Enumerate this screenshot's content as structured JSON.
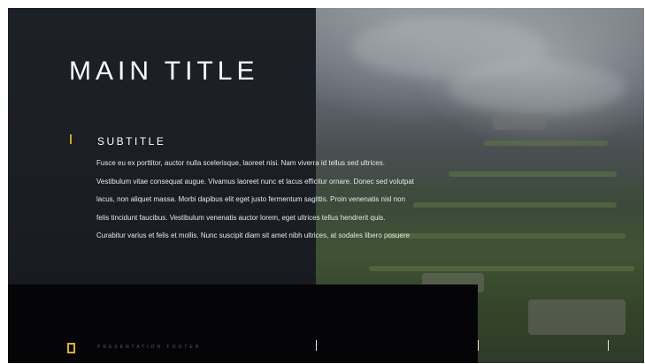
{
  "slide": {
    "title": "MAIN TITLE",
    "subtitle": "SUBTITLE",
    "body_lines": [
      "Fusce eu ex porttitor, auctor nulla scelerisque, laoreet nisi. Nam viverra id tellus sed ultrices.",
      "Vestibulum vitae consequat augue. Vivamus laoreet nunc et lacus efficitur ornare. Donec sed volutpat",
      "lacus, non aliquet massa. Morbi dapibus elit eget justo fermentum sagittis. Proin venenatis nisl non",
      "felis tincidunt faucibus. Vestibulum venenatis auctor lorem, eget ultrices tellus hendrerit quis.",
      "Curabitur varius et felis et mollis. Nunc suscipit diam sit amet nibh ultrices, at sodales libero posuere"
    ],
    "footer_text": "PRESENTATION FOOTER"
  },
  "colors": {
    "accent": "#c9a227",
    "logo": "#e0b21a",
    "panel": "#1c1f25",
    "footer_band": "#050507"
  },
  "icons": {
    "logo": "yellow-rectangle-logo-icon",
    "accent": "subtitle-accent-bar"
  }
}
